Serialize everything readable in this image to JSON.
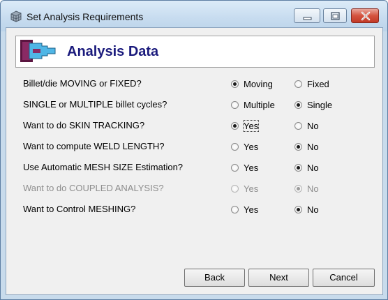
{
  "window": {
    "title": "Set Analysis Requirements",
    "title_icon": "grid-cube-icon",
    "controls": [
      "minimize",
      "maximize",
      "close"
    ]
  },
  "header": {
    "title": "Analysis Data",
    "icon": "extrusion-die-icon"
  },
  "questions": [
    {
      "label": "Billet/die MOVING or FIXED?",
      "enabled": true,
      "options": [
        {
          "label": "Moving",
          "checked": true
        },
        {
          "label": "Fixed",
          "checked": false
        }
      ]
    },
    {
      "label": "SINGLE or MULTIPLE billet cycles?",
      "enabled": true,
      "options": [
        {
          "label": "Multiple",
          "checked": false
        },
        {
          "label": "Single",
          "checked": true
        }
      ]
    },
    {
      "label": "Want to do SKIN TRACKING?",
      "enabled": true,
      "options": [
        {
          "label": "Yes",
          "checked": true,
          "focused": true
        },
        {
          "label": "No",
          "checked": false
        }
      ]
    },
    {
      "label": "Want to compute WELD LENGTH?",
      "enabled": true,
      "options": [
        {
          "label": "Yes",
          "checked": false
        },
        {
          "label": "No",
          "checked": true
        }
      ]
    },
    {
      "label": "Use Automatic MESH SIZE Estimation?",
      "enabled": true,
      "options": [
        {
          "label": "Yes",
          "checked": false
        },
        {
          "label": "No",
          "checked": true
        }
      ]
    },
    {
      "label": "Want to do COUPLED ANALYSIS?",
      "enabled": false,
      "options": [
        {
          "label": "Yes",
          "checked": false
        },
        {
          "label": "No",
          "checked": true
        }
      ]
    },
    {
      "label": "Want to Control MESHING?",
      "enabled": true,
      "options": [
        {
          "label": "Yes",
          "checked": false
        },
        {
          "label": "No",
          "checked": true
        }
      ]
    }
  ],
  "buttons": {
    "back": "Back",
    "next": "Next",
    "cancel": "Cancel"
  }
}
